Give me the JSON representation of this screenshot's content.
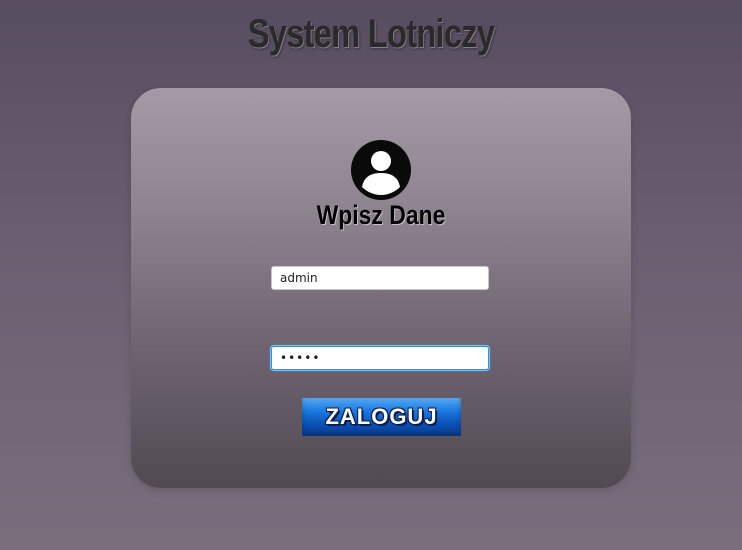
{
  "header": {
    "title": "System Lotniczy"
  },
  "login_card": {
    "icon": "user-avatar-icon",
    "title": "Wpisz Dane",
    "username": {
      "value": "admin",
      "placeholder": ""
    },
    "password": {
      "value": "admin",
      "placeholder": ""
    },
    "submit_label": "ZALOGUJ"
  },
  "colors": {
    "accent": "#1a78e0",
    "focus_ring": "#2f8fd8"
  }
}
